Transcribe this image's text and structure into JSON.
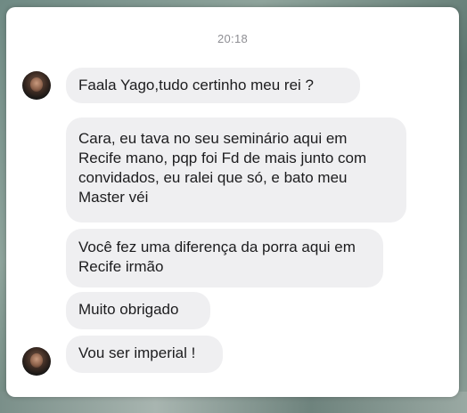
{
  "chat": {
    "timestamp": "20:18",
    "messages": [
      {
        "text": "Faala Yago,tudo certinho meu rei ?",
        "has_avatar": true
      },
      {
        "text": "Cara, eu tava no seu seminário aqui em Recife mano, pqp foi Fd de mais junto com convidados, eu ralei que só, e bato meu Master véi",
        "has_avatar": false
      },
      {
        "text": "Você fez uma diferença da porra aqui em Recife irmão",
        "has_avatar": false
      },
      {
        "text": "Muito obrigado",
        "has_avatar": false
      },
      {
        "text": "Vou ser imperial !",
        "has_avatar": true
      }
    ]
  },
  "icons": {
    "avatar": "sender-avatar-photo"
  },
  "colors": {
    "bubble_background": "#efeff1",
    "message_text": "#1c1c1e",
    "timestamp_text": "#8e8e93",
    "card_background": "#ffffff"
  }
}
